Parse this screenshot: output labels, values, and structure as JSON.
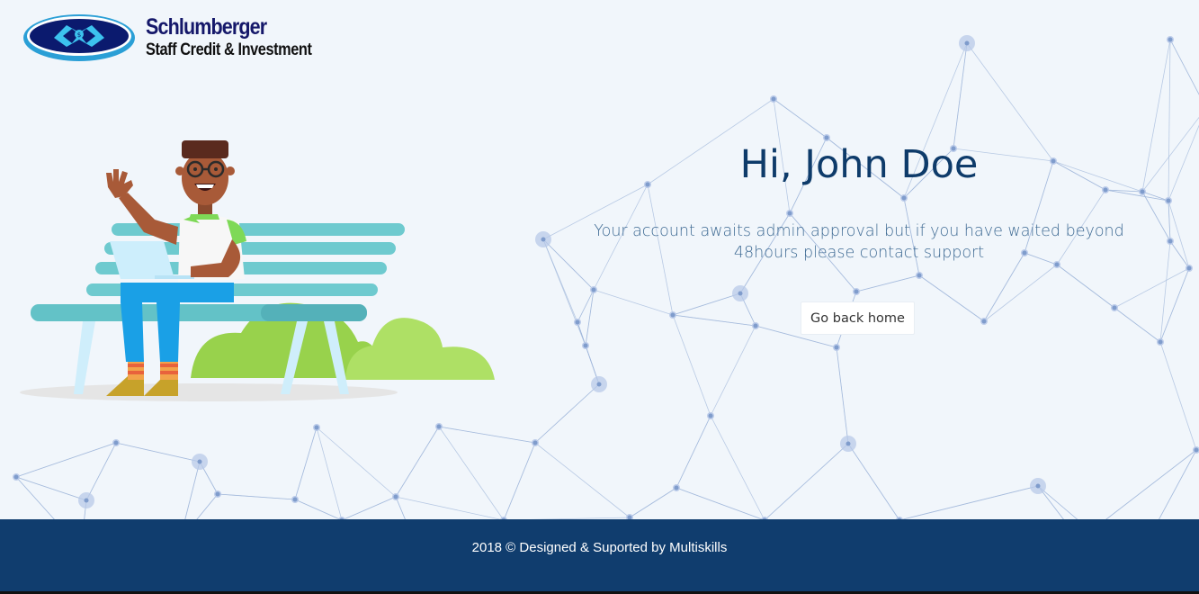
{
  "brand": {
    "name": "Schlumberger",
    "subtitle": "Staff Credit & Investment"
  },
  "main": {
    "greeting": "Hi, John Doe",
    "message": "Your account awaits admin approval but if you have waited beyond 48hours please contact support",
    "home_button": "Go back home"
  },
  "footer": {
    "text": "2018 © Designed & Suported by Multiskills"
  },
  "colors": {
    "background": "#f1f6fb",
    "heading": "#0e3b6a",
    "message": "#3e6a93",
    "footer": "#103d6e",
    "brand": "#15186a"
  }
}
